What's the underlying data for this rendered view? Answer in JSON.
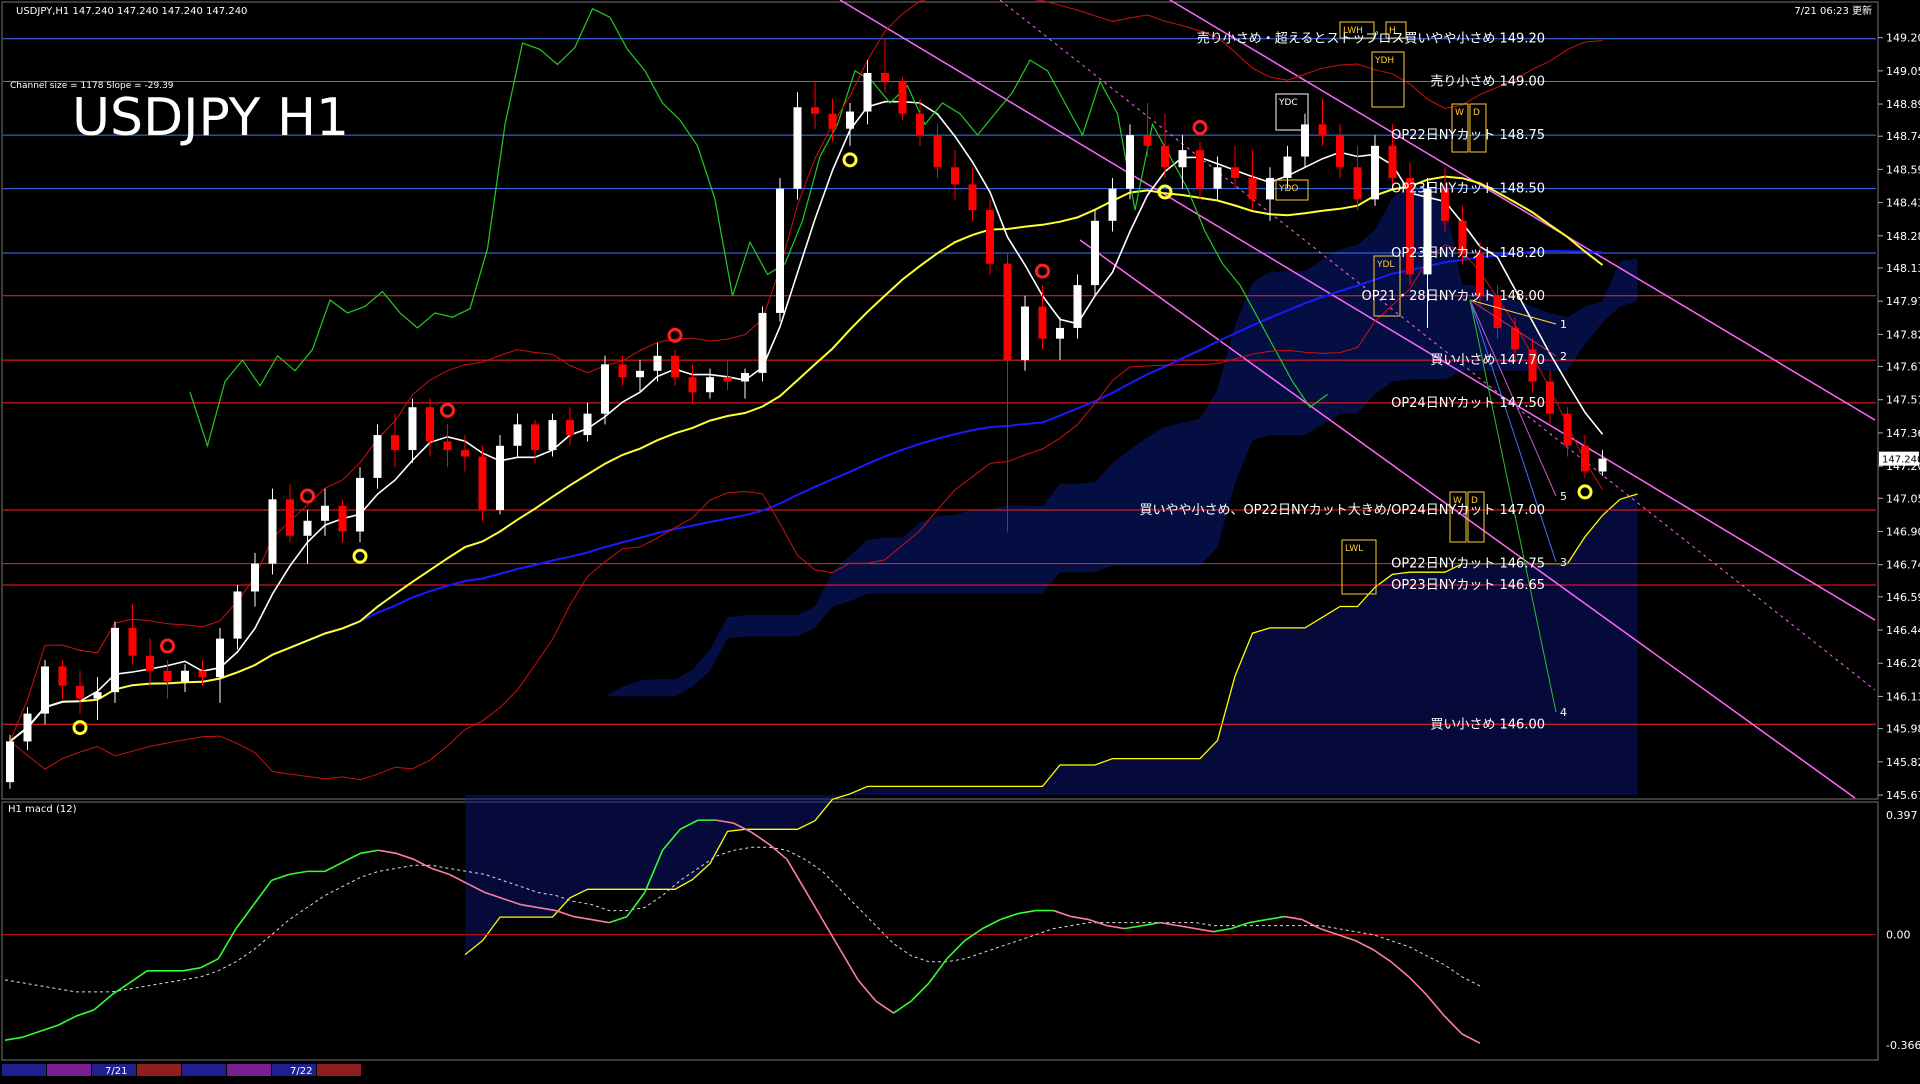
{
  "header": {
    "symbol_info": "USDJPY,H1  147.240 147.240 147.240 147.240",
    "updated": "7/21 06:23 更新",
    "channel_info": "Channel size = 1178 Slope = -29.39",
    "chart_title": "USDJPY H1"
  },
  "colors": {
    "background": "#000000",
    "bull_candle": "#ffffff",
    "bear_candle": "#ff0000",
    "level_blue": "#3a78ff",
    "level_red": "#ff2020",
    "ma_white": "#ffffff",
    "ma_yellow": "#ffff33",
    "ma_blue": "#1a1aff",
    "chikou_green": "#22cc22",
    "cloud_span_b": "#ffff00",
    "channel_magenta": "#ff66ff",
    "macd_rising": "#33ff33",
    "macd_falling": "#ff7f9f",
    "macd_signal": "#dddddd"
  },
  "chart_data": [
    {
      "type": "candlestick",
      "title": "USDJPY H1",
      "ylim": [
        145.67,
        149.25
      ],
      "y_ticks": [
        "149.205",
        "149.050",
        "148.895",
        "148.745",
        "148.590",
        "148.435",
        "148.280",
        "148.130",
        "147.975",
        "147.820",
        "147.670",
        "147.515",
        "147.360",
        "147.205",
        "147.055",
        "146.900",
        "146.745",
        "146.595",
        "146.440",
        "146.285",
        "146.130",
        "145.980",
        "145.825",
        "145.670"
      ],
      "current_price": "147.240",
      "ohlc": [
        [
          145.73,
          145.95,
          145.7,
          145.92
        ],
        [
          145.92,
          146.08,
          145.88,
          146.05
        ],
        [
          146.05,
          146.3,
          146.0,
          146.27
        ],
        [
          146.27,
          146.3,
          146.12,
          146.18
        ],
        [
          146.18,
          146.25,
          146.05,
          146.12
        ],
        [
          146.12,
          146.22,
          146.02,
          146.15
        ],
        [
          146.15,
          146.48,
          146.1,
          146.45
        ],
        [
          146.45,
          146.56,
          146.28,
          146.32
        ],
        [
          146.32,
          146.4,
          146.18,
          146.25
        ],
        [
          146.25,
          146.3,
          146.12,
          146.2
        ],
        [
          146.2,
          146.28,
          146.15,
          146.25
        ],
        [
          146.25,
          146.3,
          146.18,
          146.22
        ],
        [
          146.22,
          146.45,
          146.1,
          146.4
        ],
        [
          146.4,
          146.65,
          146.35,
          146.62
        ],
        [
          146.62,
          146.8,
          146.55,
          146.75
        ],
        [
          146.75,
          147.1,
          146.7,
          147.05
        ],
        [
          147.05,
          147.12,
          146.85,
          146.88
        ],
        [
          146.88,
          147.0,
          146.75,
          146.95
        ],
        [
          146.95,
          147.1,
          146.88,
          147.02
        ],
        [
          147.02,
          147.05,
          146.85,
          146.9
        ],
        [
          146.9,
          147.2,
          146.85,
          147.15
        ],
        [
          147.15,
          147.4,
          147.1,
          147.35
        ],
        [
          147.35,
          147.45,
          147.2,
          147.28
        ],
        [
          147.28,
          147.52,
          147.22,
          147.48
        ],
        [
          147.48,
          147.52,
          147.25,
          147.32
        ],
        [
          147.32,
          147.4,
          147.2,
          147.28
        ],
        [
          147.28,
          147.35,
          147.18,
          147.25
        ],
        [
          147.25,
          147.3,
          146.95,
          147.0
        ],
        [
          147.0,
          147.35,
          146.98,
          147.3
        ],
        [
          147.3,
          147.45,
          147.25,
          147.4
        ],
        [
          147.4,
          147.42,
          147.22,
          147.28
        ],
        [
          147.28,
          147.45,
          147.25,
          147.42
        ],
        [
          147.42,
          147.48,
          147.3,
          147.35
        ],
        [
          147.35,
          147.5,
          147.32,
          147.45
        ],
        [
          147.45,
          147.72,
          147.4,
          147.68
        ],
        [
          147.68,
          147.72,
          147.58,
          147.62
        ],
        [
          147.62,
          147.7,
          147.55,
          147.65
        ],
        [
          147.65,
          147.78,
          147.6,
          147.72
        ],
        [
          147.72,
          147.75,
          147.58,
          147.62
        ],
        [
          147.62,
          147.68,
          147.5,
          147.55
        ],
        [
          147.55,
          147.66,
          147.52,
          147.62
        ],
        [
          147.62,
          147.7,
          147.56,
          147.6
        ],
        [
          147.6,
          147.66,
          147.52,
          147.64
        ],
        [
          147.64,
          147.95,
          147.6,
          147.92
        ],
        [
          147.92,
          148.55,
          147.88,
          148.5
        ],
        [
          148.5,
          148.95,
          148.45,
          148.88
        ],
        [
          148.88,
          149.0,
          148.78,
          148.85
        ],
        [
          148.85,
          148.92,
          148.72,
          148.78
        ],
        [
          148.78,
          148.9,
          148.7,
          148.86
        ],
        [
          148.86,
          149.1,
          148.8,
          149.04
        ],
        [
          149.04,
          149.2,
          148.95,
          149.0
        ],
        [
          149.0,
          149.02,
          148.82,
          148.85
        ],
        [
          148.85,
          148.92,
          148.7,
          148.75
        ],
        [
          148.75,
          148.8,
          148.55,
          148.6
        ],
        [
          148.6,
          148.68,
          148.45,
          148.52
        ],
        [
          148.52,
          148.6,
          148.35,
          148.4
        ],
        [
          148.4,
          148.45,
          148.1,
          148.15
        ],
        [
          148.15,
          148.2,
          146.9,
          147.7
        ],
        [
          147.7,
          148.0,
          147.65,
          147.95
        ],
        [
          147.95,
          148.05,
          147.75,
          147.8
        ],
        [
          147.8,
          147.9,
          147.7,
          147.85
        ],
        [
          147.85,
          148.1,
          147.8,
          148.05
        ],
        [
          148.05,
          148.4,
          148.0,
          148.35
        ],
        [
          148.35,
          148.55,
          148.3,
          148.5
        ],
        [
          148.5,
          148.8,
          148.45,
          148.75
        ],
        [
          148.75,
          148.9,
          148.65,
          148.7
        ],
        [
          148.7,
          148.85,
          148.55,
          148.6
        ],
        [
          148.6,
          148.75,
          148.5,
          148.68
        ],
        [
          148.68,
          148.72,
          148.45,
          148.5
        ],
        [
          148.5,
          148.65,
          148.45,
          148.6
        ],
        [
          148.6,
          148.7,
          148.5,
          148.55
        ],
        [
          148.55,
          148.68,
          148.4,
          148.45
        ],
        [
          148.45,
          148.6,
          148.35,
          148.55
        ],
        [
          148.55,
          148.7,
          148.5,
          148.65
        ],
        [
          148.65,
          148.85,
          148.6,
          148.8
        ],
        [
          148.8,
          148.92,
          148.7,
          148.75
        ],
        [
          148.75,
          148.8,
          148.55,
          148.6
        ],
        [
          148.6,
          148.7,
          148.4,
          148.45
        ],
        [
          148.45,
          148.75,
          148.42,
          148.7
        ],
        [
          148.7,
          148.8,
          148.5,
          148.55
        ],
        [
          148.55,
          148.62,
          148.05,
          148.1
        ],
        [
          148.1,
          148.55,
          147.85,
          148.5
        ],
        [
          148.5,
          148.6,
          148.3,
          148.35
        ],
        [
          148.35,
          148.42,
          148.15,
          148.2
        ],
        [
          148.2,
          148.25,
          147.95,
          148.0
        ],
        [
          148.0,
          148.05,
          147.8,
          147.85
        ],
        [
          147.85,
          147.9,
          147.7,
          147.75
        ],
        [
          147.75,
          147.8,
          147.55,
          147.6
        ],
        [
          147.6,
          147.65,
          147.4,
          147.45
        ],
        [
          147.45,
          147.48,
          147.25,
          147.3
        ],
        [
          147.3,
          147.35,
          147.15,
          147.18
        ],
        [
          147.18,
          147.28,
          147.16,
          147.24
        ]
      ],
      "levels": [
        {
          "price": 149.2,
          "label": "売り小さめ・超えるとストップロス買いやや小さめ 149.20",
          "color": "#3a78ff"
        },
        {
          "price": 149.0,
          "label": "売り小さめ 149.00",
          "color": "#3a78ff"
        },
        {
          "price": 148.75,
          "label": "OP22日NYカット 148.75",
          "color": "#3a78ff"
        },
        {
          "price": 148.5,
          "label": "OP23日NYカット 148.50",
          "color": "#3a78ff"
        },
        {
          "price": 148.2,
          "label": "OP23日NYカット 148.20",
          "color": "#3a78ff"
        },
        {
          "price": 148.0,
          "label": "OP21・28日NYカット 148.00",
          "color": "#ff2020"
        },
        {
          "price": 147.7,
          "label": "買い小さめ 147.70",
          "color": "#ff2020"
        },
        {
          "price": 147.5,
          "label": "OP24日NYカット 147.50",
          "color": "#ff2020"
        },
        {
          "price": 147.0,
          "label": "買いやや小さめ、OP22日NYカット大きめ/OP24日NYカット 147.00",
          "color": "#ff2020"
        },
        {
          "price": 146.75,
          "label": "OP22日NYカット 146.75",
          "color": "#ff2020"
        },
        {
          "price": 146.65,
          "label": "OP23日NYカット 146.65",
          "color": "#ff2020"
        },
        {
          "price": 146.0,
          "label": "買い小さめ 146.00",
          "color": "#ff2020"
        }
      ],
      "box_labels": [
        "LWH",
        "H",
        "YDH",
        "W",
        "D",
        "YDC",
        "YDO",
        "YDL",
        "W",
        "D",
        "LWL"
      ],
      "projection_labels": [
        "1",
        "2",
        "5",
        "3",
        "4"
      ],
      "x_ticks": [
        "7/21",
        "7/22"
      ]
    },
    {
      "type": "line",
      "title": "H1  macd (12)",
      "ylim": [
        -0.366,
        0.397
      ],
      "y_ticks": [
        "0.397",
        "0.00",
        "-0.366"
      ],
      "macd": [
        -0.35,
        -0.34,
        -0.32,
        -0.3,
        -0.27,
        -0.25,
        -0.2,
        -0.16,
        -0.12,
        -0.12,
        -0.12,
        -0.11,
        -0.08,
        0.02,
        0.1,
        0.18,
        0.2,
        0.21,
        0.21,
        0.24,
        0.27,
        0.28,
        0.27,
        0.25,
        0.22,
        0.2,
        0.17,
        0.14,
        0.12,
        0.1,
        0.09,
        0.08,
        0.06,
        0.05,
        0.04,
        0.06,
        0.14,
        0.28,
        0.35,
        0.38,
        0.38,
        0.37,
        0.34,
        0.3,
        0.25,
        0.15,
        0.05,
        -0.05,
        -0.15,
        -0.22,
        -0.26,
        -0.22,
        -0.16,
        -0.08,
        -0.02,
        0.02,
        0.05,
        0.07,
        0.08,
        0.08,
        0.06,
        0.05,
        0.03,
        0.02,
        0.03,
        0.04,
        0.03,
        0.02,
        0.01,
        0.02,
        0.04,
        0.05,
        0.06,
        0.05,
        0.02,
        0.0,
        -0.02,
        -0.05,
        -0.09,
        -0.14,
        -0.2,
        -0.27,
        -0.33,
        -0.36
      ],
      "signal": [
        -0.15,
        -0.16,
        -0.17,
        -0.18,
        -0.19,
        -0.19,
        -0.19,
        -0.18,
        -0.17,
        -0.16,
        -0.15,
        -0.14,
        -0.12,
        -0.09,
        -0.05,
        0.0,
        0.05,
        0.09,
        0.13,
        0.16,
        0.19,
        0.21,
        0.22,
        0.23,
        0.23,
        0.22,
        0.21,
        0.2,
        0.18,
        0.16,
        0.14,
        0.13,
        0.11,
        0.1,
        0.08,
        0.08,
        0.09,
        0.13,
        0.18,
        0.22,
        0.26,
        0.28,
        0.29,
        0.29,
        0.28,
        0.25,
        0.21,
        0.15,
        0.09,
        0.03,
        -0.03,
        -0.07,
        -0.09,
        -0.09,
        -0.08,
        -0.06,
        -0.04,
        -0.02,
        0.0,
        0.02,
        0.03,
        0.04,
        0.04,
        0.04,
        0.04,
        0.04,
        0.04,
        0.04,
        0.03,
        0.03,
        0.03,
        0.03,
        0.03,
        0.03,
        0.03,
        0.02,
        0.01,
        0.0,
        -0.02,
        -0.04,
        -0.07,
        -0.1,
        -0.14,
        -0.17
      ]
    }
  ]
}
